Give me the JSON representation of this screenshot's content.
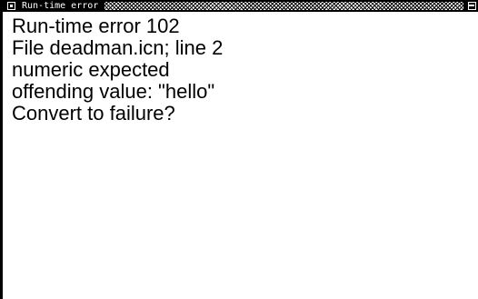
{
  "window": {
    "title": "Run-time error",
    "icons": {
      "close": "close-box-icon",
      "zoom": "zoom-box-icon"
    }
  },
  "message": {
    "lines": [
      "Run-time error 102",
      "File deadman.icn; line 2",
      "numeric expected",
      "offending value: \"hello\"",
      "Convert to failure?"
    ]
  }
}
